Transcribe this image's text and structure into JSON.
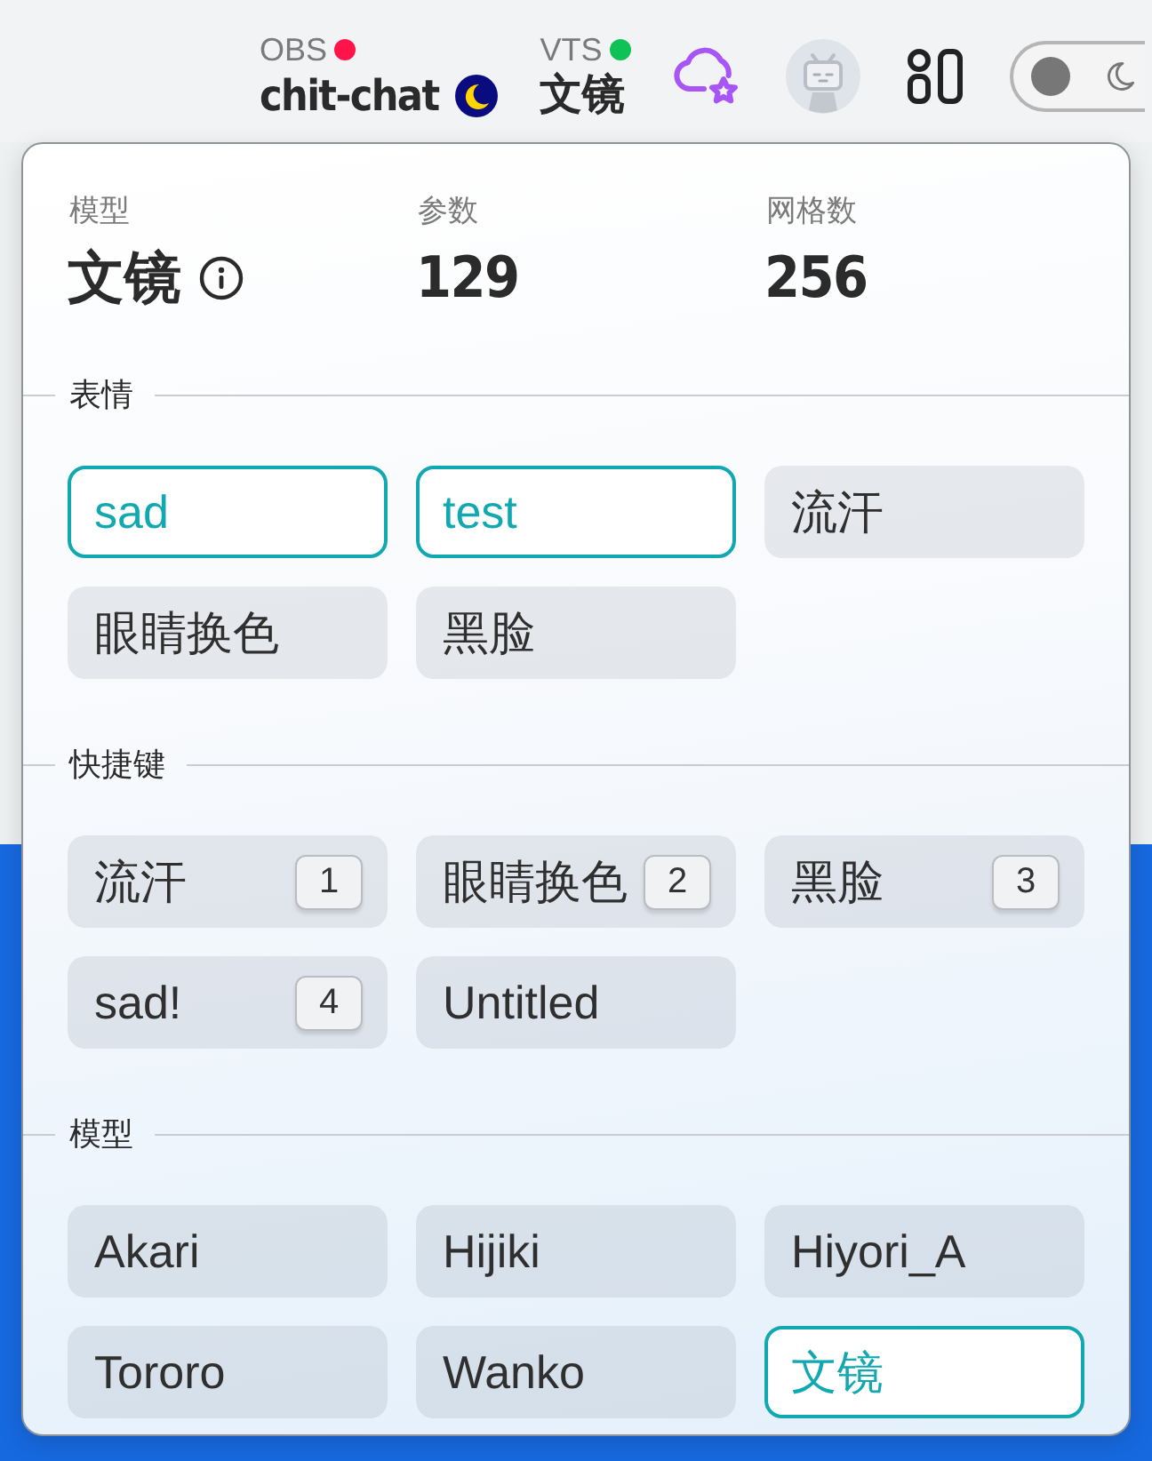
{
  "top_bar": {
    "connections": [
      {
        "kind": "obs",
        "label": "OBS",
        "color": "#ff1449",
        "value": "chit-chat"
      },
      {
        "kind": "vts",
        "label": "VTS",
        "color": "#10c158",
        "value": "文镜"
      }
    ],
    "theme_toggle": {
      "on": false
    }
  },
  "popup": {
    "stats": [
      {
        "label": "模型",
        "value": "文镜",
        "info_icon": true
      },
      {
        "label": "参数",
        "value": "129",
        "info_icon": false
      },
      {
        "label": "网格数",
        "value": "256",
        "info_icon": false
      }
    ],
    "sections": [
      {
        "title": "表情",
        "kind": "toggle",
        "items": [
          {
            "label": "sad",
            "selected": true
          },
          {
            "label": "test",
            "selected": true
          },
          {
            "label": "流汗",
            "selected": false
          },
          {
            "label": "眼睛换色",
            "selected": false
          },
          {
            "label": "黑脸",
            "selected": false
          }
        ]
      },
      {
        "title": "快捷键",
        "kind": "hotkey",
        "items": [
          {
            "label": "流汗",
            "key": "1"
          },
          {
            "label": "眼睛换色",
            "key": "2"
          },
          {
            "label": "黑脸",
            "key": "3"
          },
          {
            "label": "sad!",
            "key": "4"
          },
          {
            "label": "Untitled"
          }
        ]
      },
      {
        "title": "模型",
        "kind": "toggle",
        "items": [
          {
            "label": "Akari",
            "selected": false
          },
          {
            "label": "Hijiki",
            "selected": false
          },
          {
            "label": "Hiyori_A",
            "selected": false
          },
          {
            "label": "Tororo",
            "selected": false
          },
          {
            "label": "Wanko",
            "selected": false
          },
          {
            "label": "文镜",
            "selected": true
          }
        ]
      }
    ]
  }
}
